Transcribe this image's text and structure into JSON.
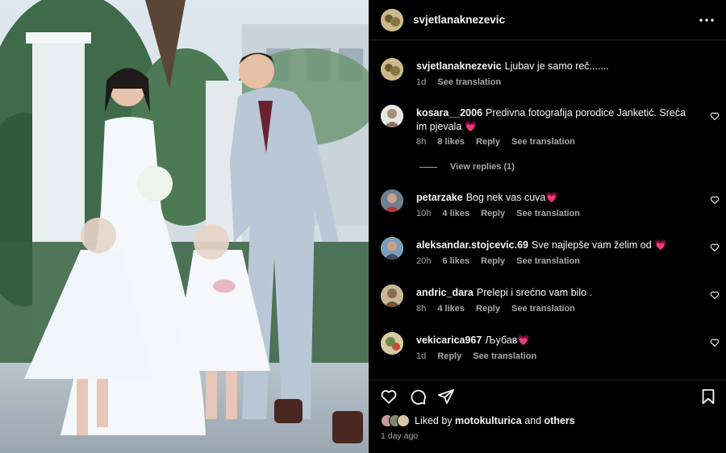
{
  "post": {
    "author": "svjetlanaknezevic",
    "caption": "Ljubav je samo reč.......",
    "caption_time": "1d",
    "caption_translate": "See translation"
  },
  "comments": [
    {
      "user": "kosara__2006",
      "text": "Predivna fotografija porodice Janketić. Sreća im pjevala 💗",
      "time": "8h",
      "likes": "8 likes",
      "reply": "Reply",
      "translate": "See translation"
    },
    {
      "user": "petarzake",
      "text": "Bog nek vas cuva💗",
      "time": "10h",
      "likes": "4 likes",
      "reply": "Reply",
      "translate": "See translation"
    },
    {
      "user": "aleksandar.stojcevic.69",
      "text": "Sve najlepše vam želim od 💗",
      "time": "20h",
      "likes": "6 likes",
      "reply": "Reply",
      "translate": "See translation"
    },
    {
      "user": "andric_dara",
      "text": "Prelepi i srećno vam bilo .",
      "time": "8h",
      "likes": "4 likes",
      "reply": "Reply",
      "translate": "See translation"
    },
    {
      "user": "vekicarica967",
      "text": "Љубав💗",
      "time": "1d",
      "likes": "",
      "reply": "Reply",
      "translate": "See translation"
    }
  ],
  "view_replies": "View replies (1)",
  "likes_line": {
    "prefix": "Liked by",
    "user": "motokulturica",
    "and": "and",
    "others": "others"
  },
  "post_age": "1 day ago",
  "colors": {
    "background": "#000000",
    "text": "#f5f5f5",
    "secondary": "#a8a8a8",
    "heart": "#ff3b77"
  }
}
